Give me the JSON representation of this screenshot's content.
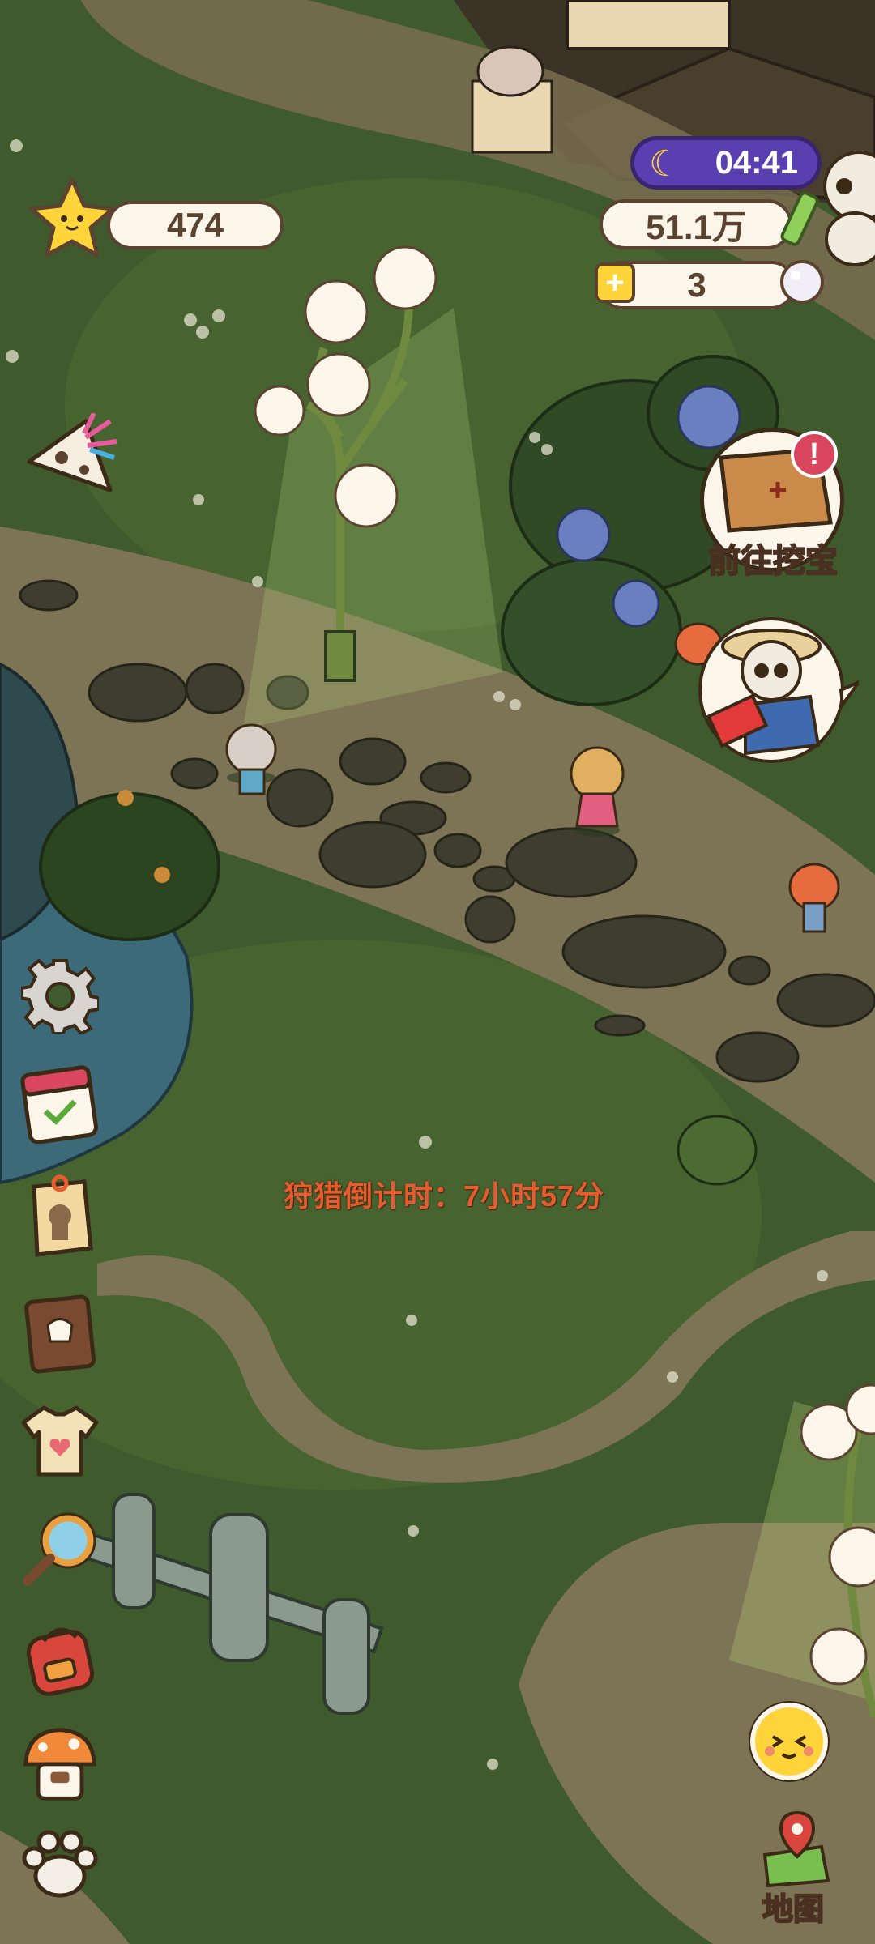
{
  "hud": {
    "stars": "474",
    "time": "04:41",
    "coins": "51.1万",
    "pearls": "3"
  },
  "treasure_button": {
    "label": "前往挖宝"
  },
  "countdown": {
    "text": "狩猎倒计时：7小时57分"
  },
  "map_button": {
    "label": "地图"
  },
  "side_menu": [
    "settings-icon",
    "calendar-icon",
    "tag-icon",
    "recipe-book-icon",
    "shirt-icon",
    "magnifier-icon",
    "backpack-icon",
    "mushroom-shop-icon",
    "paw-icon"
  ],
  "colors": {
    "grass": "#3f5a2c",
    "path": "#6f6a4f",
    "accent_purple": "#5a3fb0",
    "countdown_red": "#e85b2c"
  }
}
